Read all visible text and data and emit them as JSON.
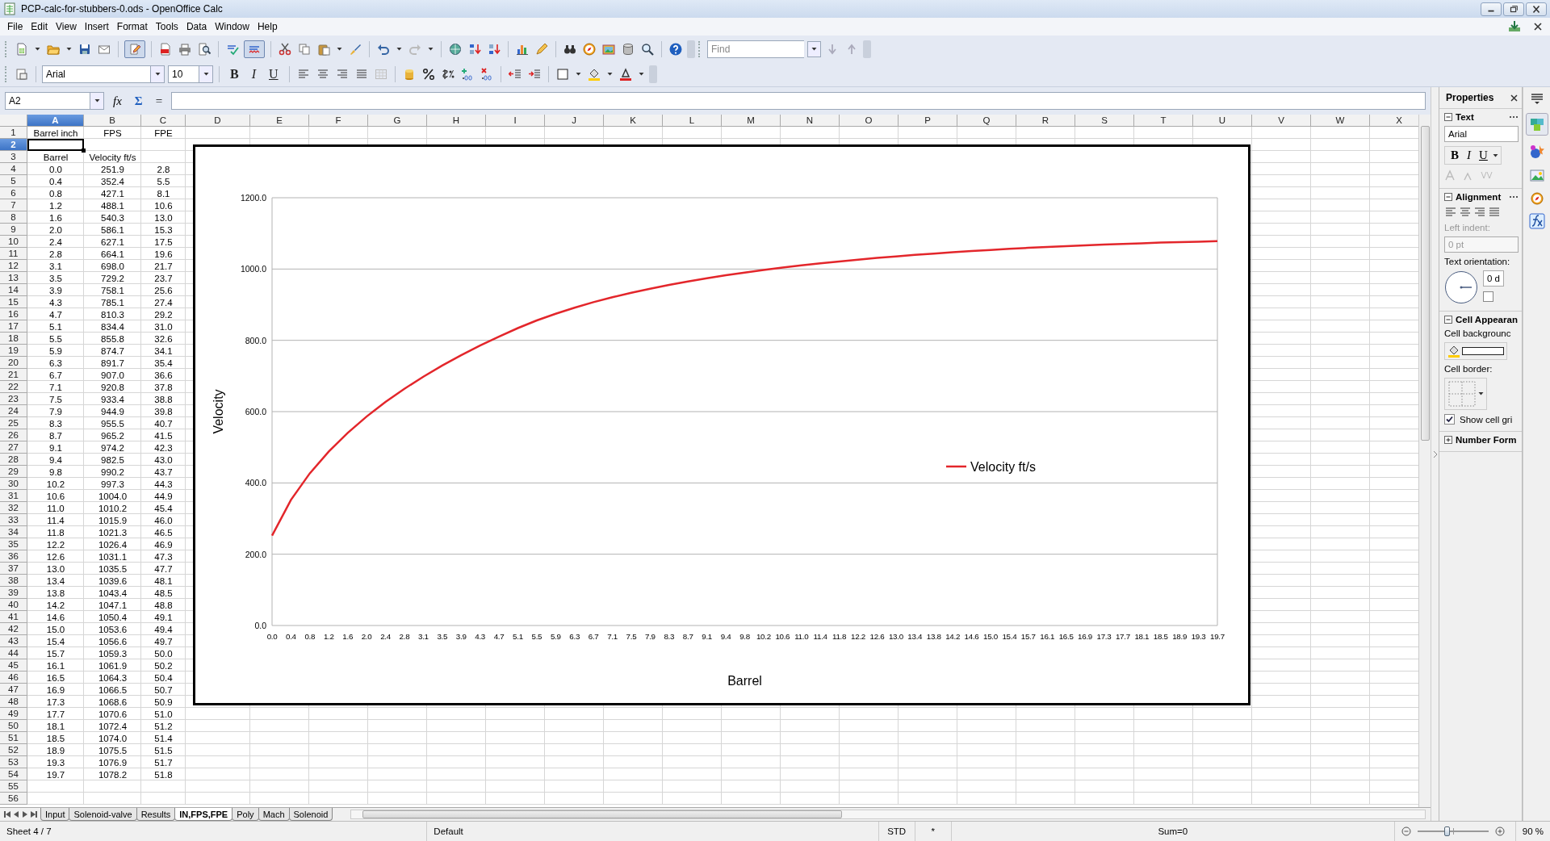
{
  "window": {
    "title": "PCP-calc-for-stubbers-0.ods - OpenOffice Calc"
  },
  "menu": [
    "File",
    "Edit",
    "View",
    "Insert",
    "Format",
    "Tools",
    "Data",
    "Window",
    "Help"
  ],
  "standard_toolbar": {
    "edit_file_on": true,
    "auto_spellcheck_on": true,
    "find_field": {
      "placeholder": "Find"
    }
  },
  "formatting_toolbar": {
    "font_name": "Arial",
    "font_size": "10",
    "style_buttons": [
      "B",
      "I",
      "U"
    ]
  },
  "formula_bar": {
    "cell_reference": "A2",
    "buttons": [
      "fx",
      "Σ",
      "="
    ]
  },
  "sheet": {
    "columns": [
      {
        "label": "A",
        "selected": true
      },
      {
        "label": "B",
        "selected": false
      },
      {
        "label": "C",
        "selected": false
      },
      {
        "label": "D",
        "selected": false
      },
      {
        "label": "E",
        "selected": false
      },
      {
        "label": "F",
        "selected": false
      },
      {
        "label": "G",
        "selected": false
      },
      {
        "label": "H",
        "selected": false
      },
      {
        "label": "I",
        "selected": false
      },
      {
        "label": "J",
        "selected": false
      },
      {
        "label": "K",
        "selected": false
      },
      {
        "label": "L",
        "selected": false
      },
      {
        "label": "M",
        "selected": false
      },
      {
        "label": "N",
        "selected": false
      },
      {
        "label": "O",
        "selected": false
      },
      {
        "label": "P",
        "selected": false
      },
      {
        "label": "Q",
        "selected": false
      },
      {
        "label": "R",
        "selected": false
      },
      {
        "label": "S",
        "selected": false
      },
      {
        "label": "T",
        "selected": false
      },
      {
        "label": "U",
        "selected": false
      },
      {
        "label": "V",
        "selected": false
      },
      {
        "label": "W",
        "selected": false
      },
      {
        "label": "X",
        "selected": false
      }
    ],
    "rows": [
      {
        "number": "1",
        "selected": false,
        "cells": [
          "Barrel inch",
          "FPS",
          "FPE"
        ]
      },
      {
        "number": "2",
        "selected": true
      },
      {
        "number": "3",
        "selected": false,
        "cells": [
          "Barrel",
          "Velocity ft/s"
        ]
      },
      {
        "number": "4",
        "selected": false,
        "cells": [
          "0.0",
          "251.9",
          "2.8"
        ]
      },
      {
        "number": "5",
        "selected": false,
        "cells": [
          "0.4",
          "352.4",
          "5.5"
        ]
      },
      {
        "number": "6",
        "selected": false,
        "cells": [
          "0.8",
          "427.1",
          "8.1"
        ]
      },
      {
        "number": "7",
        "selected": false,
        "cells": [
          "1.2",
          "488.1",
          "10.6"
        ]
      },
      {
        "number": "8",
        "selected": false,
        "cells": [
          "1.6",
          "540.3",
          "13.0"
        ]
      },
      {
        "number": "9",
        "selected": false,
        "cells": [
          "2.0",
          "586.1",
          "15.3"
        ]
      },
      {
        "number": "10",
        "selected": false,
        "cells": [
          "2.4",
          "627.1",
          "17.5"
        ]
      },
      {
        "number": "11",
        "selected": false,
        "cells": [
          "2.8",
          "664.1",
          "19.6"
        ]
      },
      {
        "number": "12",
        "selected": false,
        "cells": [
          "3.1",
          "698.0",
          "21.7"
        ]
      },
      {
        "number": "13",
        "selected": false,
        "cells": [
          "3.5",
          "729.2",
          "23.7"
        ]
      },
      {
        "number": "14",
        "selected": false,
        "cells": [
          "3.9",
          "758.1",
          "25.6"
        ]
      },
      {
        "number": "15",
        "selected": false,
        "cells": [
          "4.3",
          "785.1",
          "27.4"
        ]
      },
      {
        "number": "16",
        "selected": false,
        "cells": [
          "4.7",
          "810.3",
          "29.2"
        ]
      },
      {
        "number": "17",
        "selected": false,
        "cells": [
          "5.1",
          "834.4",
          "31.0"
        ]
      },
      {
        "number": "18",
        "selected": false,
        "cells": [
          "5.5",
          "855.8",
          "32.6"
        ]
      },
      {
        "number": "19",
        "selected": false,
        "cells": [
          "5.9",
          "874.7",
          "34.1"
        ]
      },
      {
        "number": "20",
        "selected": false,
        "cells": [
          "6.3",
          "891.7",
          "35.4"
        ]
      },
      {
        "number": "21",
        "selected": false,
        "cells": [
          "6.7",
          "907.0",
          "36.6"
        ]
      },
      {
        "number": "22",
        "selected": false,
        "cells": [
          "7.1",
          "920.8",
          "37.8"
        ]
      },
      {
        "number": "23",
        "selected": false,
        "cells": [
          "7.5",
          "933.4",
          "38.8"
        ]
      },
      {
        "number": "24",
        "selected": false,
        "cells": [
          "7.9",
          "944.9",
          "39.8"
        ]
      },
      {
        "number": "25",
        "selected": false,
        "cells": [
          "8.3",
          "955.5",
          "40.7"
        ]
      },
      {
        "number": "26",
        "selected": false,
        "cells": [
          "8.7",
          "965.2",
          "41.5"
        ]
      },
      {
        "number": "27",
        "selected": false,
        "cells": [
          "9.1",
          "974.2",
          "42.3"
        ]
      },
      {
        "number": "28",
        "selected": false,
        "cells": [
          "9.4",
          "982.5",
          "43.0"
        ]
      },
      {
        "number": "29",
        "selected": false,
        "cells": [
          "9.8",
          "990.2",
          "43.7"
        ]
      },
      {
        "number": "30",
        "selected": false,
        "cells": [
          "10.2",
          "997.3",
          "44.3"
        ]
      },
      {
        "number": "31",
        "selected": false,
        "cells": [
          "10.6",
          "1004.0",
          "44.9"
        ]
      },
      {
        "number": "32",
        "selected": false,
        "cells": [
          "11.0",
          "1010.2",
          "45.4"
        ]
      },
      {
        "number": "33",
        "selected": false,
        "cells": [
          "11.4",
          "1015.9",
          "46.0"
        ]
      },
      {
        "number": "34",
        "selected": false,
        "cells": [
          "11.8",
          "1021.3",
          "46.5"
        ]
      },
      {
        "number": "35",
        "selected": false,
        "cells": [
          "12.2",
          "1026.4",
          "46.9"
        ]
      },
      {
        "number": "36",
        "selected": false,
        "cells": [
          "12.6",
          "1031.1",
          "47.3"
        ]
      },
      {
        "number": "37",
        "selected": false,
        "cells": [
          "13.0",
          "1035.5",
          "47.7"
        ]
      },
      {
        "number": "38",
        "selected": false,
        "cells": [
          "13.4",
          "1039.6",
          "48.1"
        ]
      },
      {
        "number": "39",
        "selected": false,
        "cells": [
          "13.8",
          "1043.4",
          "48.5"
        ]
      },
      {
        "number": "40",
        "selected": false,
        "cells": [
          "14.2",
          "1047.1",
          "48.8"
        ]
      },
      {
        "number": "41",
        "selected": false,
        "cells": [
          "14.6",
          "1050.4",
          "49.1"
        ]
      },
      {
        "number": "42",
        "selected": false,
        "cells": [
          "15.0",
          "1053.6",
          "49.4"
        ]
      },
      {
        "number": "43",
        "selected": false,
        "cells": [
          "15.4",
          "1056.6",
          "49.7"
        ]
      },
      {
        "number": "44",
        "selected": false,
        "cells": [
          "15.7",
          "1059.3",
          "50.0"
        ]
      },
      {
        "number": "45",
        "selected": false,
        "cells": [
          "16.1",
          "1061.9",
          "50.2"
        ]
      },
      {
        "number": "46",
        "selected": false,
        "cells": [
          "16.5",
          "1064.3",
          "50.4"
        ]
      },
      {
        "number": "47",
        "selected": false,
        "cells": [
          "16.9",
          "1066.5",
          "50.7"
        ]
      },
      {
        "number": "48",
        "selected": false,
        "cells": [
          "17.3",
          "1068.6",
          "50.9"
        ]
      },
      {
        "number": "49",
        "selected": false,
        "cells": [
          "17.7",
          "1070.6",
          "51.0"
        ]
      },
      {
        "number": "50",
        "selected": false,
        "cells": [
          "18.1",
          "1072.4",
          "51.2"
        ]
      },
      {
        "number": "51",
        "selected": false,
        "cells": [
          "18.5",
          "1074.0",
          "51.4"
        ]
      },
      {
        "number": "52",
        "selected": false,
        "cells": [
          "18.9",
          "1075.5",
          "51.5"
        ]
      },
      {
        "number": "53",
        "selected": false,
        "cells": [
          "19.3",
          "1076.9",
          "51.7"
        ]
      },
      {
        "number": "54",
        "selected": false,
        "cells": [
          "19.7",
          "1078.2",
          "51.8"
        ]
      },
      {
        "number": "55",
        "selected": false
      },
      {
        "number": "56",
        "selected": false
      }
    ]
  },
  "chart": {
    "chart_data": {
      "type": "line",
      "grid": true,
      "xlabel": "Barrel",
      "ylabel": "Velocity",
      "categories": [
        "0.0",
        "0.4",
        "0.8",
        "1.2",
        "1.6",
        "2.0",
        "2.4",
        "2.8",
        "3.1",
        "3.5",
        "3.9",
        "4.3",
        "4.7",
        "5.1",
        "5.5",
        "5.9",
        "6.3",
        "6.7",
        "7.1",
        "7.5",
        "7.9",
        "8.3",
        "8.7",
        "9.1",
        "9.4",
        "9.8",
        "10.2",
        "10.6",
        "11.0",
        "11.4",
        "11.8",
        "12.2",
        "12.6",
        "13.0",
        "13.4",
        "13.8",
        "14.2",
        "14.6",
        "15.0",
        "15.4",
        "15.7",
        "16.1",
        "16.5",
        "16.9",
        "17.3",
        "17.7",
        "18.1",
        "18.5",
        "18.9",
        "19.3",
        "19.7"
      ],
      "series": [
        {
          "name": "Velocity ft/s",
          "color": "#e3262b",
          "values": [
            251.9,
            352.4,
            427.1,
            488.1,
            540.3,
            586.1,
            627.1,
            664.1,
            698.0,
            729.2,
            758.1,
            785.1,
            810.3,
            834.4,
            855.8,
            874.7,
            891.7,
            907.0,
            920.8,
            933.4,
            944.9,
            955.5,
            965.2,
            974.2,
            982.5,
            990.2,
            997.3,
            1004.0,
            1010.2,
            1015.9,
            1021.3,
            1026.4,
            1031.1,
            1035.5,
            1039.6,
            1043.4,
            1047.1,
            1050.4,
            1053.6,
            1056.6,
            1059.3,
            1061.9,
            1064.3,
            1066.5,
            1068.6,
            1070.6,
            1072.4,
            1074.0,
            1075.5,
            1076.9,
            1078.2
          ]
        }
      ],
      "ylim": [
        0,
        1200
      ],
      "yticks": [
        {
          "value": 0,
          "label": "0.0"
        },
        {
          "value": 200,
          "label": "200.0"
        },
        {
          "value": 400,
          "label": "400.0"
        },
        {
          "value": 600,
          "label": "600.0"
        },
        {
          "value": 800,
          "label": "800.0"
        },
        {
          "value": 1000,
          "label": "1000.0"
        },
        {
          "value": 1200,
          "label": "1200.0"
        }
      ]
    }
  },
  "sheet_tabs": [
    {
      "label": "Input",
      "selected": false
    },
    {
      "label": "Solenoid-valve",
      "selected": false
    },
    {
      "label": "Results",
      "selected": false
    },
    {
      "label": "IN,FPS,FPE",
      "selected": true
    },
    {
      "label": "Poly",
      "selected": false
    },
    {
      "label": "Mach",
      "selected": false
    },
    {
      "label": "Solenoid",
      "selected": false
    }
  ],
  "sidebar": {
    "title": "Properties",
    "text_section": {
      "title": "Text",
      "expanded": true,
      "font_name": "Arial",
      "style_buttons": [
        "B",
        "I",
        "U"
      ]
    },
    "alignment_section": {
      "title": "Alignment",
      "expanded": true,
      "left_indent_label": "Left indent:",
      "left_indent_value": "0 pt",
      "left_indent_disabled": true,
      "orientation_label": "Text orientation:",
      "orientation_value": "0 d",
      "stacked_checked": false
    },
    "cell_appearance_section": {
      "title": "Cell Appearan",
      "expanded": true,
      "background_label": "Cell backgrounc",
      "border_label": "Cell border:",
      "show_grid_label": "Show cell gri",
      "show_grid_checked": true
    },
    "number_format_section": {
      "title": "Number Form",
      "expanded": false
    }
  },
  "status_bar": {
    "sheet": "Sheet 4 / 7",
    "page_style": "Default",
    "mode": "STD",
    "modified": "*",
    "sum": "Sum=0",
    "zoom": "90 %",
    "zoom_slider": {
      "level": 0.41
    }
  }
}
